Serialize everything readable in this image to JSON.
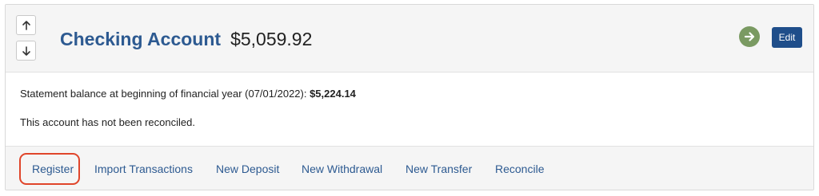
{
  "account": {
    "name": "Checking Account",
    "balance": "$5,059.92"
  },
  "header": {
    "sort_up_icon": "arrow-up-icon",
    "sort_down_icon": "arrow-down-icon",
    "go_icon": "arrow-right-circle-icon",
    "edit_label": "Edit"
  },
  "details": {
    "statement_prefix": "Statement balance at beginning of financial year (07/01/2022): ",
    "statement_amount": "$5,224.14",
    "reconcile_status": "This account has not been reconciled."
  },
  "actions": {
    "register": "Register",
    "import_transactions": "Import Transactions",
    "new_deposit": "New Deposit",
    "new_withdrawal": "New Withdrawal",
    "new_transfer": "New Transfer",
    "reconcile": "Reconcile"
  },
  "colors": {
    "link": "#2d5a91",
    "edit_button": "#1f4e8a",
    "go_button": "#7a9a62",
    "highlight": "#e0452a"
  }
}
